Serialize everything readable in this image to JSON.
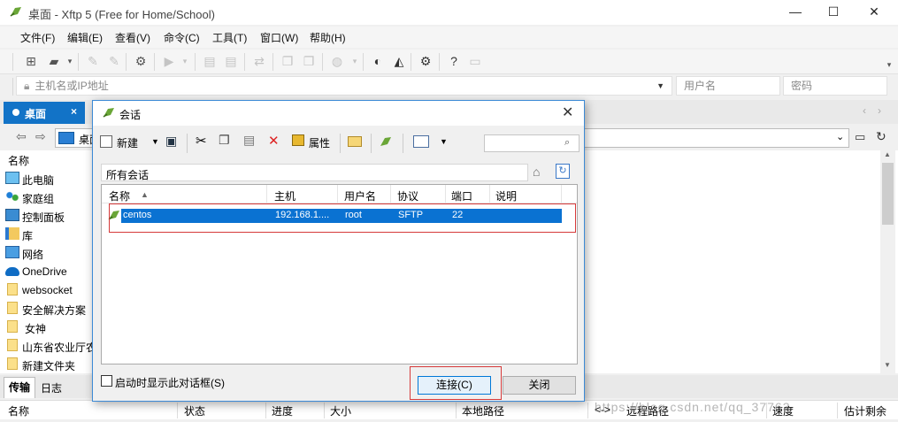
{
  "window": {
    "title": "桌面 - Xftp 5 (Free for Home/School)",
    "minimize": "—",
    "maximize": "☐",
    "close": "✕"
  },
  "menubar": [
    "文件(F)",
    "编辑(E)",
    "查看(V)",
    "命令(C)",
    "工具(T)",
    "窗口(W)",
    "帮助(H)"
  ],
  "addressbar": {
    "host_placeholder": "主机名或IP地址",
    "username_placeholder": "用户名",
    "password_placeholder": "密码"
  },
  "tabs": [
    {
      "label": "桌面",
      "active": true,
      "close": "×"
    }
  ],
  "path": {
    "current": "桌面"
  },
  "filelist": {
    "header": "名称",
    "items": [
      {
        "icon": "computer-icon",
        "label": "此电脑"
      },
      {
        "icon": "homegroup-icon",
        "label": "家庭组"
      },
      {
        "icon": "control-panel-icon",
        "label": "控制面板"
      },
      {
        "icon": "library-icon",
        "label": "库"
      },
      {
        "icon": "network-icon",
        "label": "网络"
      },
      {
        "icon": "onedrive-icon",
        "label": "OneDrive"
      },
      {
        "icon": "folder-icon",
        "label": "websocket"
      },
      {
        "icon": "folder-icon",
        "label": "安全解决方案"
      },
      {
        "icon": "folder-icon",
        "label": "女神"
      },
      {
        "icon": "folder-icon",
        "label": "山东省农业厅农"
      },
      {
        "icon": "folder-icon",
        "label": "新建文件夹"
      }
    ]
  },
  "bottom": {
    "tabs": [
      "传输",
      "日志"
    ],
    "columns": [
      "名称",
      "状态",
      "进度",
      "大小",
      "本地路径",
      "<->",
      "远程路径",
      "速度",
      "估计剩余"
    ]
  },
  "dialog": {
    "title": "会话",
    "close": "✕",
    "toolbar": {
      "new_label": "新建",
      "properties_label": "属性"
    },
    "folder": "所有会话",
    "columns": [
      "名称",
      "主机",
      "用户名",
      "协议",
      "端口",
      "说明"
    ],
    "sessions": [
      {
        "name": "centos",
        "host": "192.168.1....",
        "user": "root",
        "protocol": "SFTP",
        "port": "22",
        "desc": ""
      }
    ],
    "show_on_startup_label": "启动时显示此对话框(S)",
    "show_on_startup_checked": false,
    "connect_label": "连接(C)",
    "close_label": "关闭"
  },
  "watermark": "https://blog.csdn.net/qq_37763"
}
